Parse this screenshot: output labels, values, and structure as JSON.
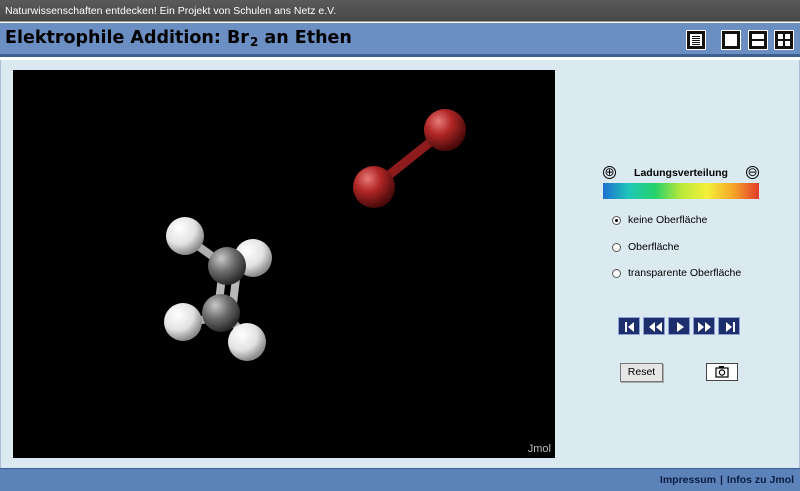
{
  "topbar": {
    "text": "Naturwissenschaften entdecken!  Ein Projekt von Schulen ans Netz e.V."
  },
  "header": {
    "title_prefix": "Elektrophile Addition: Br",
    "title_subscript": "2",
    "title_suffix": " an Ethen",
    "buttons": [
      "text-view-icon",
      "single-view-icon",
      "split-view-icon",
      "quad-view-icon"
    ]
  },
  "viewer": {
    "label": "Jmol",
    "background": "#000000",
    "atom_colors": {
      "bromine": "#a51d1d",
      "carbon": "#707070",
      "hydrogen": "#f0f0f0"
    }
  },
  "panel": {
    "charge": {
      "plus": "⊕",
      "minus": "⊖",
      "title": "Ladungsverteilung"
    },
    "surface_options": [
      {
        "label": "keine Oberfläche",
        "checked": true
      },
      {
        "label": "Oberfläche",
        "checked": false
      },
      {
        "label": "transparente Oberfläche",
        "checked": false
      }
    ],
    "player_buttons": [
      "first-frame-icon",
      "rewind-icon",
      "play-icon",
      "fast-forward-icon",
      "last-frame-icon"
    ],
    "reset_label": "Reset",
    "snapshot_icon": "camera-icon"
  },
  "footer": {
    "impressum": "Impressum",
    "separator": "|",
    "infos": "Infos zu Jmol"
  }
}
